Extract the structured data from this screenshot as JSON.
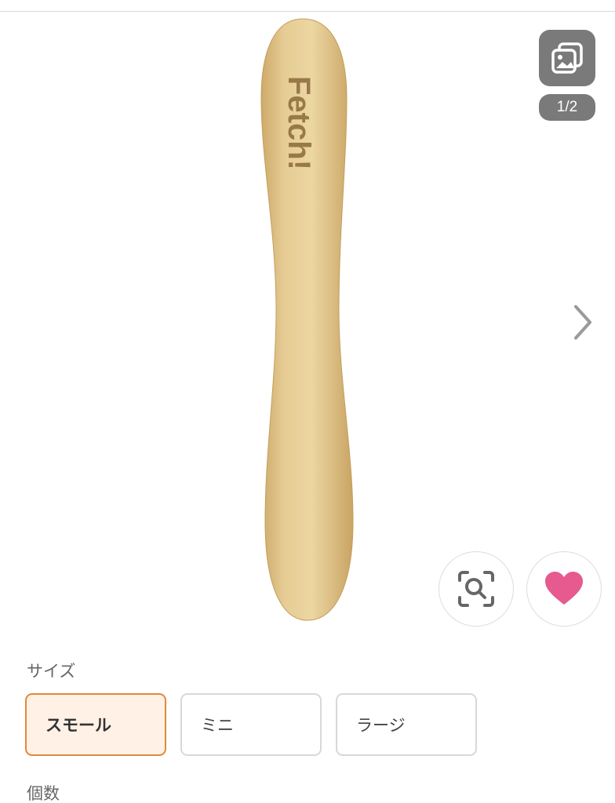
{
  "gallery": {
    "product_engraving": "Fetch!",
    "counter": "1/2",
    "icons": {
      "gallery": "image-stack-icon",
      "next": "chevron-right-icon",
      "zoom": "zoom-scan-icon",
      "favorite": "heart-icon"
    },
    "colors": {
      "favorite": "#e65a8f",
      "badge": "#7a7a7a"
    }
  },
  "size": {
    "label": "サイズ",
    "options": [
      {
        "label": "スモール",
        "selected": true
      },
      {
        "label": "ミニ",
        "selected": false
      },
      {
        "label": "ラージ",
        "selected": false
      }
    ]
  },
  "quantity": {
    "label": "個数"
  },
  "colors": {
    "selected_border": "#e08a3a",
    "selected_bg": "#fff1e6"
  }
}
